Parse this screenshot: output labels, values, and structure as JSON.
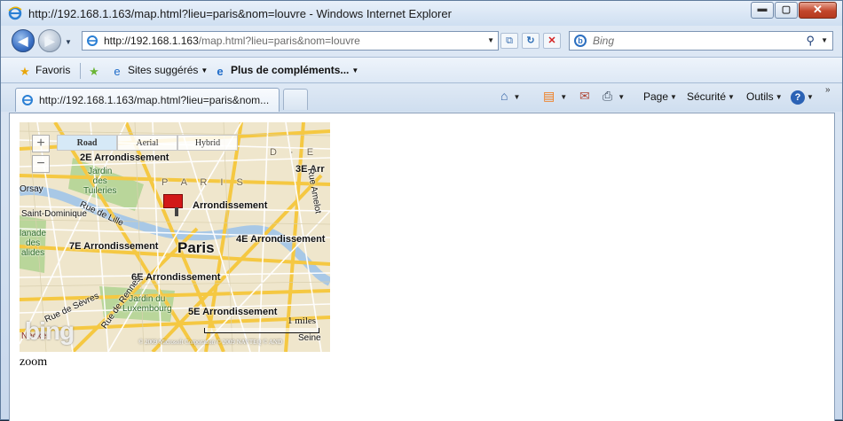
{
  "window": {
    "title": "http://192.168.1.163/map.html?lieu=paris&nom=louvre - Windows Internet Explorer",
    "controls": {
      "minimize": "▬",
      "maximize": "▢",
      "close": "✕"
    }
  },
  "navigation": {
    "back_glyph": "◀",
    "forward_glyph": "▶",
    "dropdown_glyph": "▼"
  },
  "address": {
    "host": "http://192.168.1.163",
    "path": "/map.html?lieu=paris&nom=louvre",
    "dropdown_glyph": "▼",
    "compat_glyph": "⧉",
    "refresh_glyph": "↻",
    "stop_glyph": "✕"
  },
  "search": {
    "placeholder": "Bing",
    "engine_glyph": "b",
    "search_glyph": "⚲",
    "dropdown_glyph": "▼"
  },
  "favorites_bar": {
    "favorites_label": "Favoris",
    "favorites_glyph": "★",
    "add_glyph": "★",
    "suggested_label": "Sites suggérés",
    "more_label": "Plus de compléments...",
    "site_glyph": "e",
    "caret": "▼"
  },
  "tabs": [
    {
      "title": "http://192.168.1.163/map.html?lieu=paris&nom..."
    }
  ],
  "command_bar": {
    "home_glyph": "⌂",
    "feeds_glyph": "▤",
    "mail_glyph": "✉",
    "print_glyph": "⎙",
    "page_label": "Page",
    "security_label": "Sécurité",
    "tools_label": "Outils",
    "help_glyph": "?",
    "caret": "▼",
    "more_glyph": "»"
  },
  "map": {
    "zoom_in": "+",
    "zoom_out": "−",
    "map_types": [
      "Road",
      "Aerial",
      "Hybrid"
    ],
    "active_type": "Road",
    "labels": {
      "arr2": "2E Arrondissement",
      "arr3": "3E Arr",
      "arr1": "Arrondissement",
      "arr4": "4E Arrondissement",
      "arr7": "7E Arrondissement",
      "arr6": "6E Arrondissement",
      "arr5": "5E Arrondissement",
      "city": "Paris",
      "district": "P A R I S",
      "district_letters": "D · E",
      "tuileries": "Jardin\ndes\nTuileries",
      "luxembourg": "Jardin du\nLuxembourg",
      "esplanade": "lanade\ndes\nalides",
      "orsay": "Orsay",
      "st_dominique": "Saint-Dominique",
      "rue_lille": "Rue de Lille",
      "rue_sevres": "Rue de Sèvres",
      "rue_rennes": "Rue de Rennes",
      "rue_amelot": "Rue Amelot",
      "necker": "Necker",
      "seine": "Seine"
    },
    "scale_label": "1 miles",
    "copyright": "© 2009 Microsoft Corporation  © 2009 NAVTEQ  © AND",
    "logo": "bing",
    "colors": {
      "land": "#efe6cc",
      "water": "#a8c8e6",
      "park": "#b9d69a",
      "major_road": "#f5c842",
      "minor_road": "#ffffff",
      "pin": "#d21818"
    }
  },
  "page_text": {
    "zoom": "zoom"
  }
}
